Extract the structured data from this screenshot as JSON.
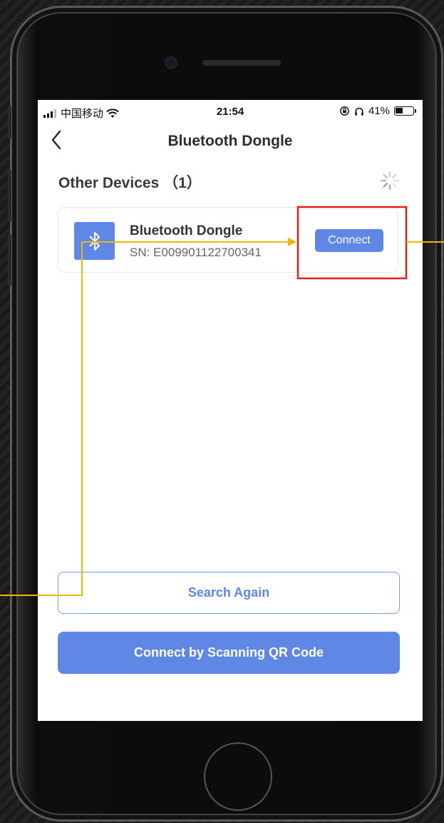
{
  "status_bar": {
    "carrier": "中国移动",
    "time": "21:54",
    "battery": "41%",
    "icons": [
      "signal-icon",
      "wifi-icon",
      "lock-rotation-icon",
      "headphones-icon",
      "battery-icon"
    ]
  },
  "nav": {
    "back_icon": "chevron-left-icon",
    "title": "Bluetooth Dongle"
  },
  "section": {
    "title": "Other Devices （1）",
    "loading_icon": "loading-spinner-icon"
  },
  "devices": [
    {
      "icon": "bluetooth-icon",
      "name": "Bluetooth Dongle",
      "sn": "SN: E009901122700341",
      "action_label": "Connect"
    }
  ],
  "buttons": {
    "search_again": "Search Again",
    "scan_qr": "Connect by Scanning QR Code"
  },
  "colors": {
    "accent": "#5f87e6",
    "annotation_line": "#f5b400",
    "highlight_box": "#e0201c"
  }
}
